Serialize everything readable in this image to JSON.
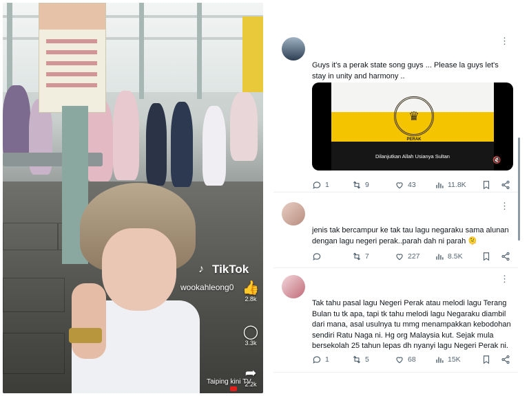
{
  "video": {
    "tiktok_brand": "TikTok",
    "username": "wookahleong0",
    "like_count": "2.8k",
    "comment_count": "3.3k",
    "share_count": "2.2k",
    "watermark": "Taiping kini TV",
    "icons": {
      "like": "thumbs-up-icon",
      "comment": "comment-bubble-icon",
      "share": "share-arrow-icon",
      "music": "tiktok-note-icon"
    }
  },
  "thread": {
    "posts": [
      {
        "text": "Guys it's a perak state song guys ... Please la guys let's stay in unity and harmony ..",
        "embed": {
          "crest_label": "PERAK",
          "caption": "Dilanjutkan Allah Usianya Sultan"
        },
        "replies": "1",
        "reposts": "9",
        "likes": "43",
        "views": "11.8K"
      },
      {
        "text": "jenis tak bercampur ke tak tau lagu negaraku sama alunan dengan lagu negeri perak..parah dah ni parah 🫠",
        "replies": "",
        "reposts": "7",
        "likes": "227",
        "views": "8.5K"
      },
      {
        "text": "Tak tahu pasal lagu Negeri Perak atau melodi lagu Terang Bulan tu tk apa, tapi tk tahu melodi lagu Negaraku diambil dari mana, asal usulnya tu mmg menampakkan kebodohan sendiri Ratu Naga ni. Hg org Malaysia kut. Sejak mula bersekolah 25 tahun lepas dh nyanyi lagu Negeri Perak ni.",
        "replies": "1",
        "reposts": "5",
        "likes": "68",
        "views": "15K"
      }
    ],
    "more_glyph": "⋮"
  },
  "colors": {
    "text": "#0f1419",
    "muted": "#536471",
    "flag_yellow": "#f5c400"
  }
}
